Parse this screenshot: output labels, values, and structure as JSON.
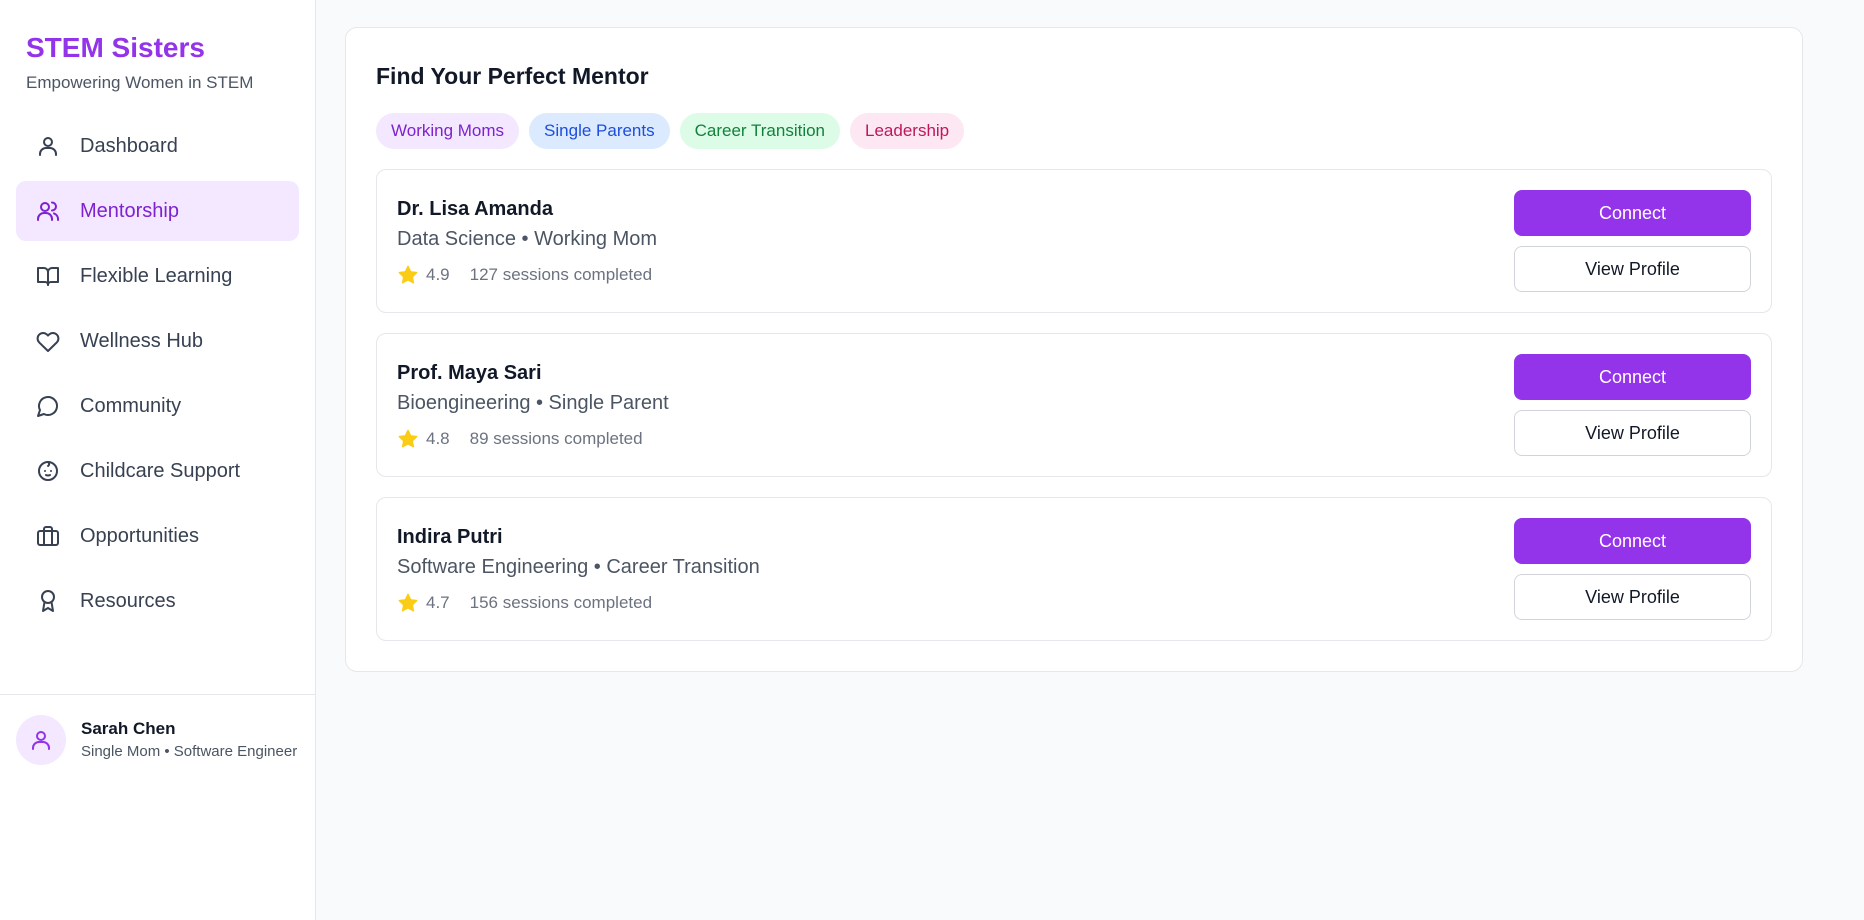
{
  "brand": {
    "title": "STEM Sisters",
    "subtitle": "Empowering Women in STEM",
    "accent_color": "#9333ea"
  },
  "sidebar": {
    "items": [
      {
        "label": "Dashboard",
        "icon": "user-icon",
        "active": false
      },
      {
        "label": "Mentorship",
        "icon": "users-icon",
        "active": true
      },
      {
        "label": "Flexible Learning",
        "icon": "book-open-icon",
        "active": false
      },
      {
        "label": "Wellness Hub",
        "icon": "heart-icon",
        "active": false
      },
      {
        "label": "Community",
        "icon": "message-circle-icon",
        "active": false
      },
      {
        "label": "Childcare Support",
        "icon": "baby-icon",
        "active": false
      },
      {
        "label": "Opportunities",
        "icon": "briefcase-icon",
        "active": false
      },
      {
        "label": "Resources",
        "icon": "award-icon",
        "active": false
      }
    ]
  },
  "user": {
    "name": "Sarah Chen",
    "role": "Single Mom • Software Engineer",
    "icon": "user-icon"
  },
  "main": {
    "title": "Find Your Perfect Mentor",
    "tags": [
      {
        "label": "Working Moms",
        "bg": "#f3e8ff",
        "fg": "#7e22ce"
      },
      {
        "label": "Single Parents",
        "bg": "#dbeafe",
        "fg": "#1d4ed8"
      },
      {
        "label": "Career Transition",
        "bg": "#dcfce7",
        "fg": "#15803d"
      },
      {
        "label": "Leadership",
        "bg": "#fce7f3",
        "fg": "#be185d"
      }
    ],
    "mentors": [
      {
        "name": "Dr. Lisa Amanda",
        "field": "Data Science • Working Mom",
        "rating": "4.9",
        "sessions": "127 sessions completed"
      },
      {
        "name": "Prof. Maya Sari",
        "field": "Bioengineering • Single Parent",
        "rating": "4.8",
        "sessions": "89 sessions completed"
      },
      {
        "name": "Indira Putri",
        "field": "Software Engineering • Career Transition",
        "rating": "4.7",
        "sessions": "156 sessions completed"
      }
    ],
    "connect_label": "Connect",
    "view_profile_label": "View Profile",
    "star_color": "#facc15"
  }
}
